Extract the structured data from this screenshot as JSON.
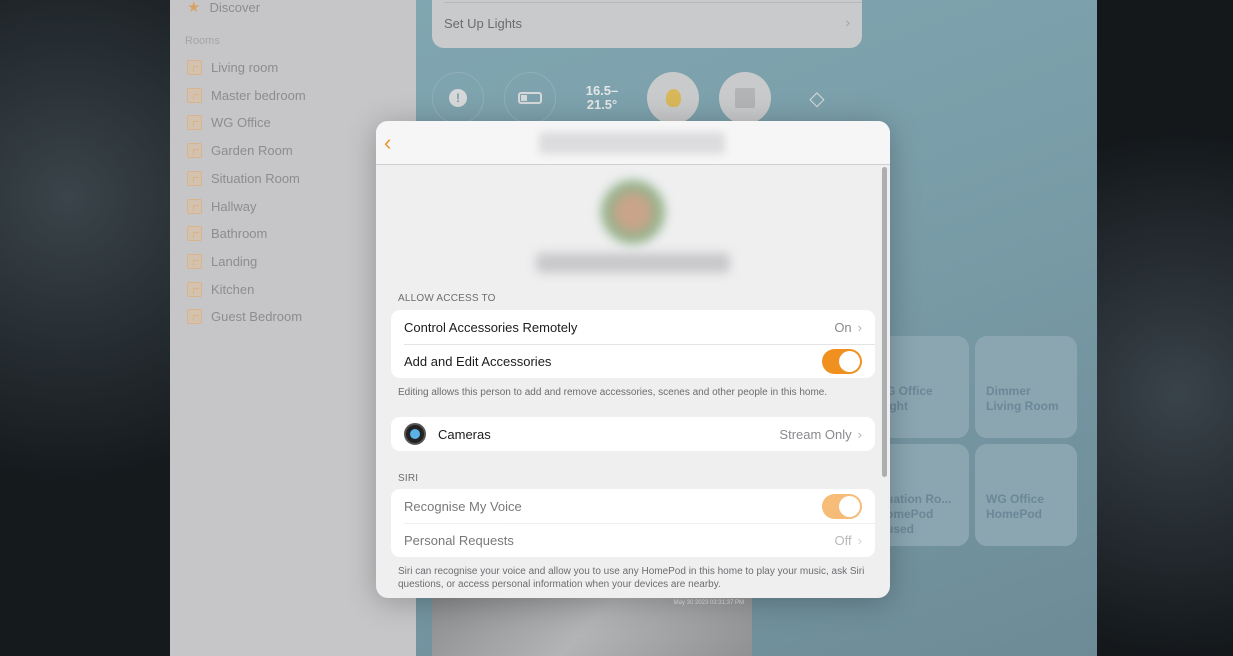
{
  "sidebar": {
    "discover": "Discover",
    "rooms_label": "Rooms",
    "rooms": [
      "Living room",
      "Master bedroom",
      "WG Office",
      "Garden Room",
      "Situation Room",
      "Hallway",
      "Bathroom",
      "Landing",
      "Kitchen",
      "Guest Bedroom"
    ]
  },
  "main": {
    "setup_lights": "Set Up Lights",
    "status": {
      "temperature": "16.5–\n21.5°"
    },
    "tiles": [
      {
        "name": "G Office\night"
      },
      {
        "name": "Dimmer\nLiving Room"
      },
      {
        "name": "uation Ro...\nomePod\nused"
      },
      {
        "name": "WG Office\nHomePod"
      }
    ],
    "camera_timestamp": "May 30 2023 03:31:37 PM"
  },
  "modal": {
    "allow_access_label": "ALLOW ACCESS TO",
    "control_remote": {
      "label": "Control Accessories Remotely",
      "value": "On"
    },
    "add_edit": {
      "label": "Add and Edit Accessories",
      "on": true
    },
    "editing_note": "Editing allows this person to add and remove accessories, scenes and other people in this home.",
    "cameras": {
      "label": "Cameras",
      "value": "Stream Only"
    },
    "siri_label": "SIRI",
    "recognise_voice": {
      "label": "Recognise My Voice",
      "on": true
    },
    "personal_requests": {
      "label": "Personal Requests",
      "value": "Off"
    },
    "siri_note": "Siri can recognise your voice and allow you to use any HomePod in this home to play your music, ask Siri questions, or access personal information when your devices are nearby."
  },
  "colors": {
    "accent": "#f0901f"
  }
}
